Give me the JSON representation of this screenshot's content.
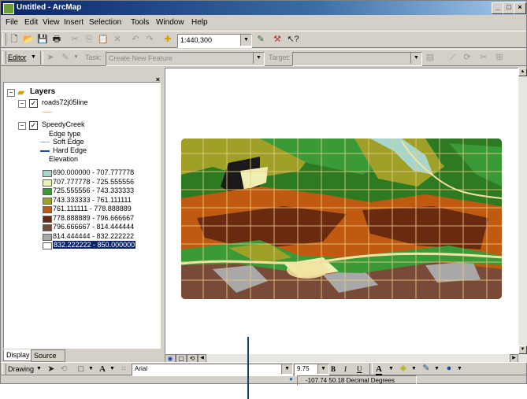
{
  "window": {
    "title": "Untitled - ArcMap"
  },
  "menu": [
    "File",
    "Edit",
    "View",
    "Insert",
    "Selection",
    "Tools",
    "Window",
    "Help"
  ],
  "standard_toolbar": {
    "scale": "1:440,300"
  },
  "editor_toolbar": {
    "editor_label": "Editor",
    "task_label": "Task:",
    "task_value": "Create New Feature",
    "target_label": "Target:",
    "target_value": ""
  },
  "toc": {
    "root": "Layers",
    "layers": [
      {
        "name": "roads72j05line"
      },
      {
        "name": "SpeedyCreek",
        "legend_headings": [
          "Edge type",
          "Elevation"
        ],
        "edge_types": [
          "Soft Edge",
          "Hard Edge"
        ],
        "elevation_classes": [
          {
            "label": "690.000000 - 707.777778",
            "color": "#a9d6cc"
          },
          {
            "label": "707.777778 - 725.555556",
            "color": "#efefb4"
          },
          {
            "label": "725.555556 - 743.333333",
            "color": "#3a9a38"
          },
          {
            "label": "743.333333 - 761.111111",
            "color": "#a0a028"
          },
          {
            "label": "761.111111 - 778.888889",
            "color": "#c05a10"
          },
          {
            "label": "778.888889 - 796.666667",
            "color": "#6a2a10"
          },
          {
            "label": "796.666667 - 814.444444",
            "color": "#7a4a38"
          },
          {
            "label": "814.444444 - 832.222222",
            "color": "#a8a8a8"
          },
          {
            "label": "832.222222 - 850.000000",
            "color": "#ffffff"
          }
        ]
      }
    ]
  },
  "tabs": [
    "Display",
    "Source"
  ],
  "drawing_toolbar": {
    "drawing_label": "Drawing",
    "font": "Arial",
    "font_size": "9.75",
    "bold": "B",
    "italic": "I",
    "underline": "U",
    "text_tool": "A"
  },
  "status": {
    "coords": "-107.74  50.18 Decimal Degrees"
  },
  "colors": {
    "selection": "#0a246a",
    "titlebar": "#0a246a"
  }
}
